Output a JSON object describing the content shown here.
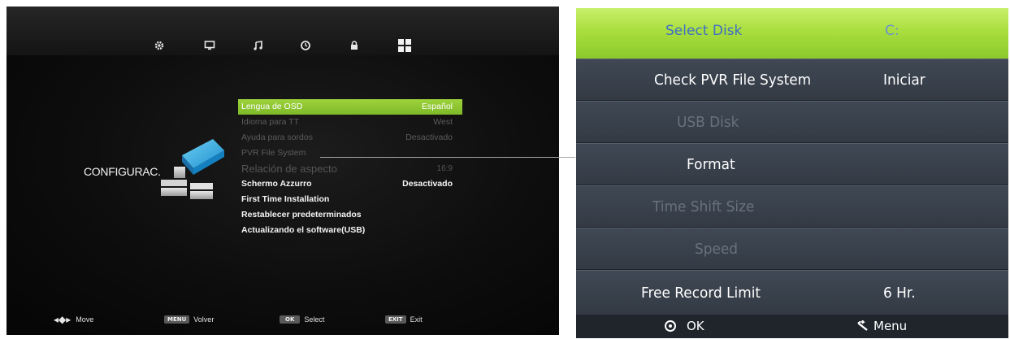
{
  "left_screen": {
    "tab_icons": [
      "settings-icon",
      "picture-icon",
      "music-note-icon",
      "clock-icon",
      "lock-icon",
      "grid-icon"
    ],
    "section_label": "CONFIGURAC.",
    "menu": [
      {
        "label": "Lengua de OSD",
        "value": "Español"
      },
      {
        "label": "Idioma para TT",
        "value": "West"
      },
      {
        "label": "Ayuda para sordos",
        "value": "Desactivado"
      },
      {
        "label": "PVR File System",
        "value": ""
      },
      {
        "label": "Relación de aspecto",
        "value": "16:9"
      },
      {
        "label": "Schermo Azzurro",
        "value": "Desactivado"
      },
      {
        "label": "First Time Installation",
        "value": ""
      },
      {
        "label": "Restablecer predeterminados",
        "value": ""
      },
      {
        "label": "Actualizando el software(USB)",
        "value": ""
      }
    ],
    "hints": [
      {
        "key": "",
        "label": "Move"
      },
      {
        "key": "MENU",
        "label": "Volver"
      },
      {
        "key": "OK",
        "label": "Select"
      },
      {
        "key": "EXIT",
        "label": "Exit"
      }
    ]
  },
  "right_screen": {
    "header": {
      "label": "Select Disk",
      "value": "C:"
    },
    "rows": [
      {
        "label": "Check PVR File System",
        "value": "Iniciar"
      },
      {
        "label": "USB Disk",
        "value": ""
      },
      {
        "label": "Format",
        "value": ""
      },
      {
        "label": "Time Shift Size",
        "value": ""
      },
      {
        "label": "Speed",
        "value": ""
      },
      {
        "label": "Free Record Limit",
        "value": "6 Hr."
      }
    ],
    "footer": {
      "ok_label": "OK",
      "menu_label": "Menu"
    }
  },
  "colors": {
    "highlight_green": "#9ed33c",
    "header_green": "#a9de3e",
    "header_text_blue": "#3f6ec5",
    "row_gray": "#3a424d"
  }
}
